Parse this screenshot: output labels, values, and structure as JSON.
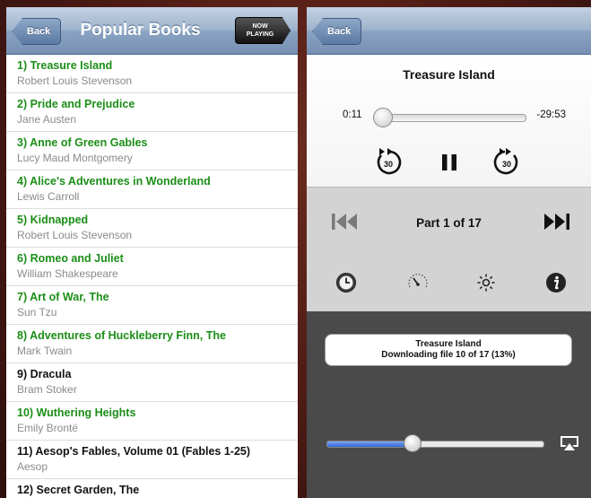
{
  "left": {
    "navbar": {
      "back_label": "Back",
      "title": "Popular Books",
      "now_playing_line1": "NOW",
      "now_playing_line2": "PLAYING"
    },
    "books": [
      {
        "title": "1) Treasure Island",
        "author": "Robert Louis Stevenson"
      },
      {
        "title": "2) Pride and Prejudice",
        "author": "Jane Austen"
      },
      {
        "title": "3) Anne of Green Gables",
        "author": "Lucy Maud Montgomery"
      },
      {
        "title": "4) Alice's Adventures in Wonderland",
        "author": "Lewis Carroll"
      },
      {
        "title": "5) Kidnapped",
        "author": "Robert Louis Stevenson"
      },
      {
        "title": "6) Romeo and Juliet",
        "author": "William Shakespeare"
      },
      {
        "title": "7) Art of War, The",
        "author": "Sun Tzu"
      },
      {
        "title": "8) Adventures of Huckleberry Finn, The",
        "author": "Mark Twain"
      },
      {
        "title": "9) Dracula",
        "author": "Bram Stoker"
      },
      {
        "title": "10) Wuthering Heights",
        "author": "Emily Brontë"
      },
      {
        "title": "11) Aesop's Fables, Volume 01 (Fables 1-25)",
        "author": "Aesop"
      },
      {
        "title": "12) Secret Garden, The",
        "author": ""
      }
    ],
    "title_colors": {
      "green": "#1b8e17",
      "black": "#111111"
    }
  },
  "right": {
    "navbar": {
      "back_label": "Back"
    },
    "player": {
      "track_title": "Treasure Island",
      "time_elapsed": "0:11",
      "time_remaining": "-29:53",
      "skip_back_label": "30",
      "skip_forward_label": "30",
      "part_label": "Part 1 of 17"
    },
    "download": {
      "title": "Treasure Island",
      "status": "Downloading file 10 of 17 (13%)"
    },
    "volume_level": 0.39,
    "icons": [
      "clock-icon",
      "speed-icon",
      "brightness-icon",
      "info-icon",
      "airplay-icon"
    ]
  }
}
